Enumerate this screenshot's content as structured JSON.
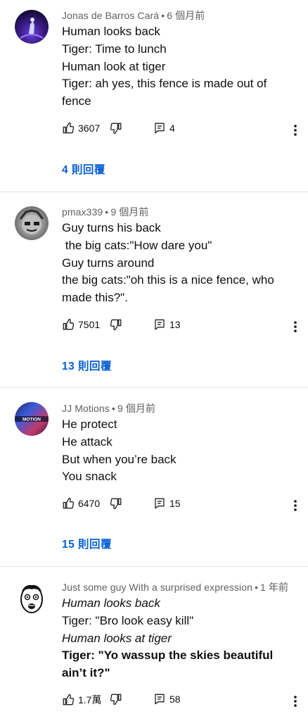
{
  "comments": [
    {
      "author": "Jonas de Barros Cará",
      "time": "6 個月前",
      "lines": [
        "Human looks back",
        "Tiger: Time to lunch",
        "Human look at tiger",
        "Tiger: ah yes, this fence is made out of",
        "fence"
      ],
      "likes": "3607",
      "reply_count": "4",
      "replies_label": "4 則回覆"
    },
    {
      "author": "pmax339",
      "time": "9 個月前",
      "lines": [
        "Guy turns his back",
        " the big cats:\"How dare you\"",
        "Guy turns around",
        "the big cats:\"oh this is a nice fence, who",
        "made this?\"."
      ],
      "likes": "7501",
      "reply_count": "13",
      "replies_label": "13 則回覆"
    },
    {
      "author": "JJ Motions",
      "time": "9 個月前",
      "lines": [
        "He protect",
        "He attack",
        "But when you’re back",
        "You snack"
      ],
      "likes": "6470",
      "reply_count": "15",
      "replies_label": "15 則回覆"
    },
    {
      "author": "Just some guy With a surprised expression",
      "time": "1 年前",
      "lines": [
        "Human looks back",
        "Tiger: \"Bro look easy kill\"",
        "Human looks at tiger",
        "Tiger: \"Yo wassup the skies beautiful",
        "ain’t it?\""
      ],
      "likes": "1.7萬",
      "reply_count": "58"
    }
  ],
  "avatar2_text": "MOTION",
  "icons": {
    "like": "thumbs-up-icon",
    "dislike": "thumbs-down-icon",
    "reply": "reply-comment-icon",
    "more": "more-vertical-icon"
  },
  "colors": {
    "link": "#065fd4",
    "meta": "#606060",
    "divider": "#e5e5e5"
  }
}
